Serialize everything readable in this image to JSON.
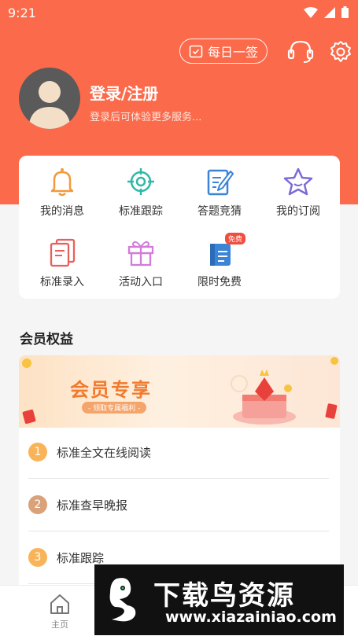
{
  "status_bar": {
    "time": "9:21"
  },
  "header": {
    "sign_in_label": "每日一签",
    "login_title": "登录/注册",
    "login_subtitle": "登录后可体验更多服务..."
  },
  "features": [
    {
      "label": "我的消息",
      "icon": "bell-icon"
    },
    {
      "label": "标准跟踪",
      "icon": "target-icon"
    },
    {
      "label": "答题竞猜",
      "icon": "quiz-edit-icon"
    },
    {
      "label": "我的订阅",
      "icon": "star-icon"
    },
    {
      "label": "标准录入",
      "icon": "documents-icon"
    },
    {
      "label": "活动入口",
      "icon": "gift-icon"
    },
    {
      "label": "限时免费",
      "icon": "free-book-icon",
      "tag": "免费"
    }
  ],
  "member": {
    "section_title": "会员权益",
    "banner_title": "会员专享",
    "banner_subtitle": "- 领取专属福利 -",
    "benefits": [
      {
        "num": "1",
        "label": "标准全文在线阅读",
        "color": "#f9b45a"
      },
      {
        "num": "2",
        "label": "标准查早晚报",
        "color": "#d9a27a"
      },
      {
        "num": "3",
        "label": "标准跟踪",
        "color": "#f9b45a"
      }
    ]
  },
  "bottom_nav": {
    "home_label": "主页"
  },
  "watermark": {
    "title": "下载鸟资源",
    "url": "www.xiazainiao.com"
  },
  "colors": {
    "accent": "#fb6a4a",
    "icon_orange": "#f29a3a",
    "icon_teal": "#2fb8a7",
    "icon_blue": "#3b84d6",
    "icon_purple": "#7c6ad8",
    "icon_red": "#e8605a",
    "icon_pink": "#d37bd9"
  }
}
